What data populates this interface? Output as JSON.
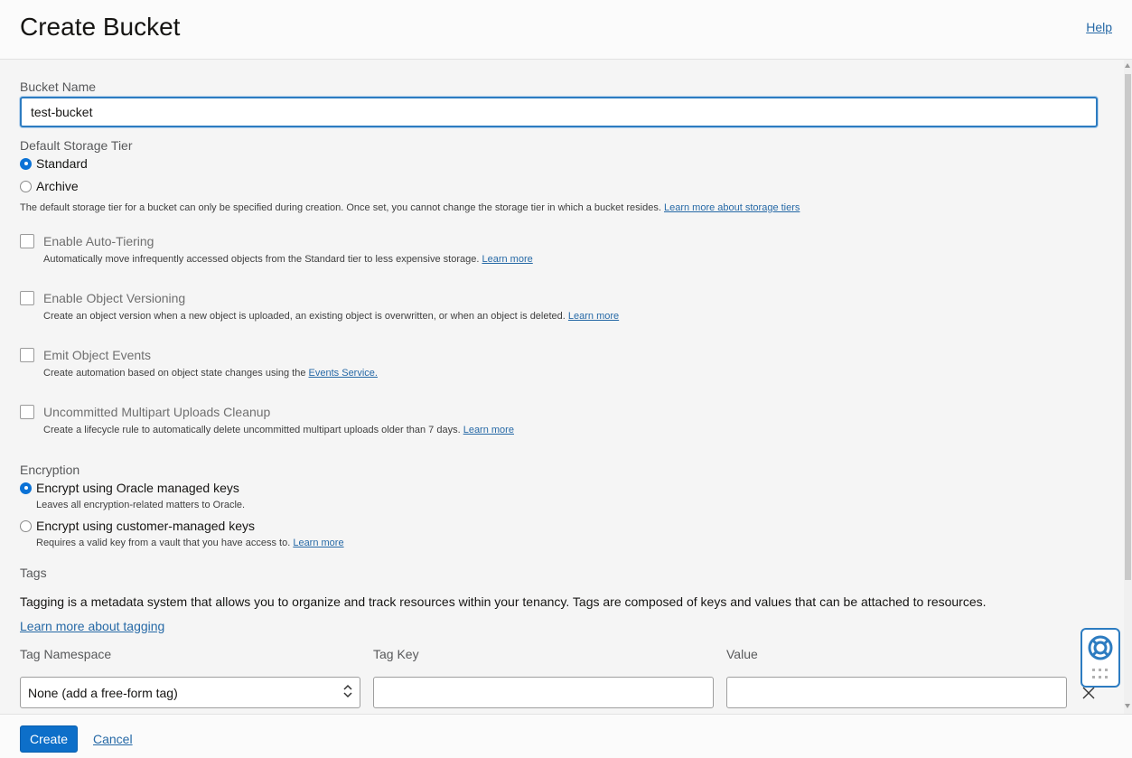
{
  "header": {
    "title": "Create Bucket",
    "help_label": "Help"
  },
  "bucket_name": {
    "label": "Bucket Name",
    "value": "test-bucket"
  },
  "storage_tier": {
    "label": "Default Storage Tier",
    "options": [
      {
        "label": "Standard",
        "checked": true
      },
      {
        "label": "Archive",
        "checked": false
      }
    ],
    "note": "The default storage tier for a bucket can only be specified during creation. Once set, you cannot change the storage tier in which a bucket resides.",
    "note_link": "Learn more about storage tiers"
  },
  "options": {
    "auto_tiering": {
      "label": "Enable Auto-Tiering",
      "desc": "Automatically move infrequently accessed objects from the Standard tier to less expensive storage.",
      "link": "Learn more"
    },
    "versioning": {
      "label": "Enable Object Versioning",
      "desc": "Create an object version when a new object is uploaded, an existing object is overwritten, or when an object is deleted.",
      "link": "Learn more"
    },
    "events": {
      "label": "Emit Object Events",
      "desc": "Create automation based on object state changes using the",
      "link": "Events Service."
    },
    "multipart_cleanup": {
      "label": "Uncommitted Multipart Uploads Cleanup",
      "desc": "Create a lifecycle rule to automatically delete uncommitted multipart uploads older than 7 days.",
      "link": "Learn more"
    }
  },
  "encryption": {
    "label": "Encryption",
    "oracle": {
      "label": "Encrypt using Oracle managed keys",
      "desc": "Leaves all encryption-related matters to Oracle."
    },
    "customer": {
      "label": "Encrypt using customer-managed keys",
      "desc": "Requires a valid key from a vault that you have access to.",
      "link": "Learn more"
    }
  },
  "tags": {
    "label": "Tags",
    "desc": "Tagging is a metadata system that allows you to organize and track resources within your tenancy. Tags are composed of keys and values that can be attached to resources.",
    "link": "Learn more about tagging",
    "col_namespace": "Tag Namespace",
    "col_key": "Tag Key",
    "col_value": "Value",
    "namespace_value": "None (add a free-form tag)",
    "key_value": "",
    "value_value": ""
  },
  "footer": {
    "create_label": "Create",
    "cancel_label": "Cancel"
  },
  "colors": {
    "accent": "#0d6fc9",
    "link": "#2669a6",
    "focus": "#2d7cc1"
  }
}
